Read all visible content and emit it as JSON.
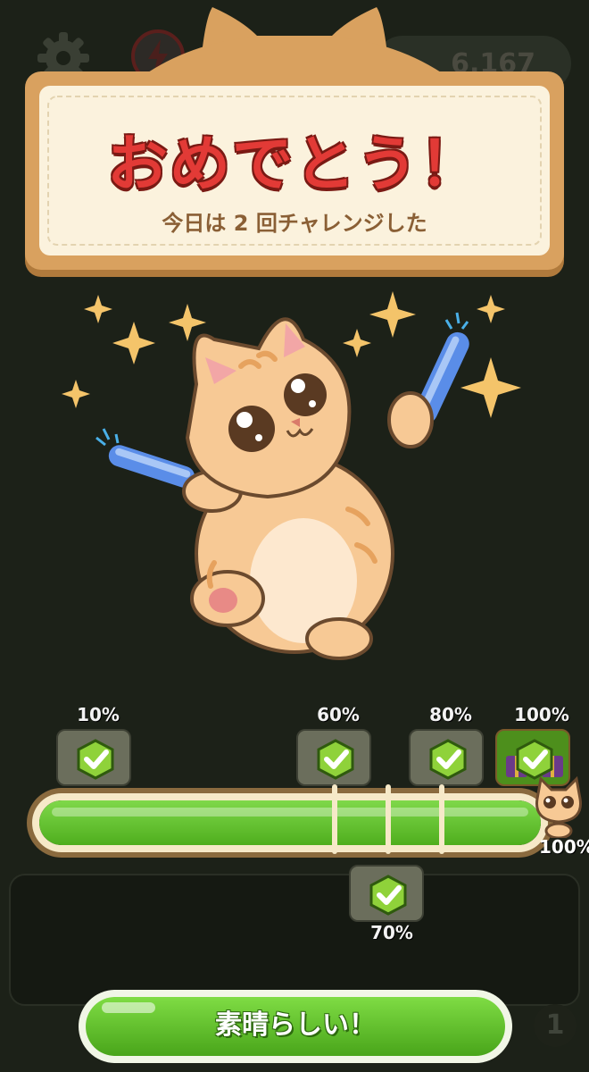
{
  "background_hud": {
    "coin_count": "6,167",
    "icons": [
      "gear-icon",
      "badge-icon"
    ]
  },
  "banner": {
    "title": "おめでとう！",
    "subtitle": "今日は 2 回チャレンジした"
  },
  "milestones": [
    {
      "label": "10%",
      "completed": true
    },
    {
      "label": "60%",
      "completed": true
    },
    {
      "label": "70%",
      "completed": true
    },
    {
      "label": "80%",
      "completed": true
    },
    {
      "label": "100%",
      "completed": true
    }
  ],
  "progress": {
    "value_percent": 100,
    "end_label": "100%"
  },
  "button": {
    "label": "素晴らしい！"
  },
  "notification": {
    "count": "1"
  },
  "colors": {
    "title_red": "#e23a36",
    "bar_green": "#5cc62a",
    "banner_wood": "#d9a15f",
    "banner_paper": "#fbf2dd"
  }
}
